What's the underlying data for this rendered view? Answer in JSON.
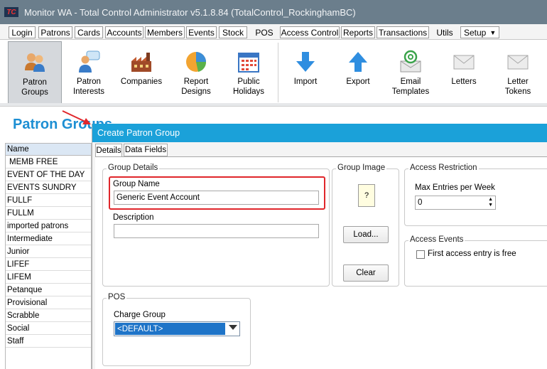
{
  "window": {
    "logo_text": "TC",
    "title": "Monitor WA - Total Control Administrator v5.1.8.84 (TotalControl_RockinghamBC)"
  },
  "menu": {
    "tabs": [
      "Login",
      "Patrons",
      "Cards",
      "Accounts",
      "Members",
      "Events",
      "Stock",
      "POS",
      "Access Control",
      "Reports",
      "Transactions",
      "Utils"
    ],
    "setup_label": "Setup",
    "setup_arrow": "▼"
  },
  "ribbon": {
    "buttons": [
      {
        "line1": "Patron",
        "line2": "Groups",
        "icon": "people-icon"
      },
      {
        "line1": "Patron",
        "line2": "Interests",
        "icon": "person-chat-icon"
      },
      {
        "line1": "Companies",
        "line2": "",
        "icon": "factory-icon"
      },
      {
        "line1": "Report",
        "line2": "Designs",
        "icon": "pie-chart-icon"
      },
      {
        "line1": "Public",
        "line2": "Holidays",
        "icon": "calendar-icon"
      },
      {
        "line1": "Import",
        "line2": "",
        "icon": "arrow-down-icon"
      },
      {
        "line1": "Export",
        "line2": "",
        "icon": "arrow-up-icon"
      },
      {
        "line1": "Email",
        "line2": "Templates",
        "icon": "email-at-icon"
      },
      {
        "line1": "Letters",
        "line2": "",
        "icon": "envelope-icon"
      },
      {
        "line1": "Letter",
        "line2": "Tokens",
        "icon": "envelope-icon"
      }
    ]
  },
  "page": {
    "heading": "Patron Groups"
  },
  "list": {
    "header": "Name",
    "rows": [
      "MEMB FREE",
      "EVENT OF THE DAY",
      "EVENTS SUNDRY",
      "FULLF",
      "FULLM",
      "imported patrons",
      "Intermediate",
      "Junior",
      "LIFEF",
      "LIFEM",
      "Petanque",
      "Provisional",
      "Scrabble",
      "Social",
      "Staff"
    ]
  },
  "dialog": {
    "title": "Create Patron Group",
    "tabs": [
      "Details",
      "Data Fields"
    ],
    "group_details": {
      "legend": "Group Details",
      "group_name_label": "Group Name",
      "group_name_value": "Generic Event Account",
      "description_label": "Description",
      "description_value": ""
    },
    "group_image": {
      "legend": "Group Image",
      "placeholder": "?",
      "load_button": "Load...",
      "clear_button": "Clear"
    },
    "access_restriction": {
      "legend": "Access Restriction",
      "max_entries_label": "Max Entries per Week",
      "max_entries_value": "0"
    },
    "access_events": {
      "legend": "Access Events",
      "first_entry_free_label": "First access entry is free",
      "first_entry_free_checked": false
    },
    "pos": {
      "legend": "POS",
      "charge_group_label": "Charge Group",
      "charge_group_value": "<DEFAULT>"
    }
  },
  "colors": {
    "accent": "#1ba1d9",
    "heading": "#1d8fd3",
    "highlight": "#e0262b",
    "titlebar": "#6b7e8c",
    "select_bg": "#1e74c8"
  }
}
